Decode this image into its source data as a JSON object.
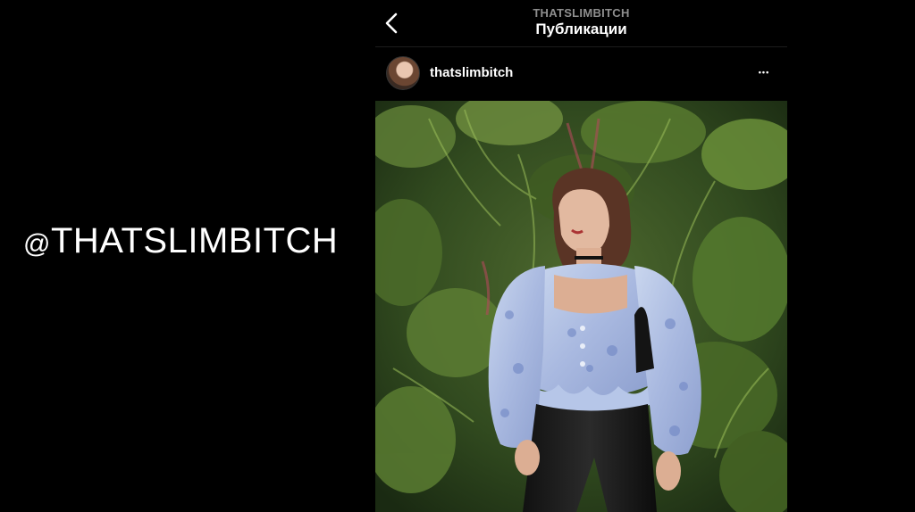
{
  "slide": {
    "at_symbol": "@",
    "handle_text": "THATSLIMBITCH"
  },
  "nav": {
    "back_icon": "chevron-left-icon",
    "account": "THATSLIMBITCH",
    "title": "Публикации"
  },
  "post": {
    "username": "thatslimbitch",
    "more_icon": "more-horizontal-icon",
    "more_glyph": "•••"
  },
  "colors": {
    "background": "#000000",
    "text_primary": "#ffffff",
    "text_secondary": "#8e8e8e"
  }
}
